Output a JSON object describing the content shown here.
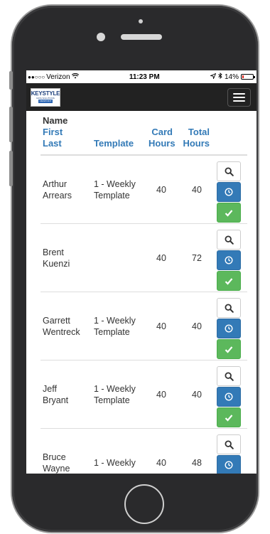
{
  "status_bar": {
    "signal": "●●○○○",
    "carrier": "Verizon",
    "wifi_icon": "wifi-icon",
    "time": "11:23 PM",
    "battery_pct": "14%",
    "battery_level": 0.14
  },
  "navbar": {
    "logo_line1": "KEYSTYLE",
    "logo_line2": "DATA SOLUTIONS",
    "logo_line3": "VIEWPOINT"
  },
  "table": {
    "headers": {
      "name": "Name",
      "first": "First",
      "last": "Last",
      "template": "Template",
      "card_line1": "Card",
      "card_line2": "Hours",
      "total_line1": "Total",
      "total_line2": "Hours"
    },
    "rows": [
      {
        "first": "Arthur",
        "last": "Arrears",
        "template": "1 - Weekly Template",
        "card_hours": "40",
        "total_hours": "40",
        "show_approve": true
      },
      {
        "first": "Brent",
        "last": "Kuenzi",
        "template": "",
        "card_hours": "40",
        "total_hours": "72",
        "show_approve": true
      },
      {
        "first": "Garrett",
        "last": "Wentreck",
        "template": "1 - Weekly Template",
        "card_hours": "40",
        "total_hours": "40",
        "show_approve": true
      },
      {
        "first": "Jeff",
        "last": "Bryant",
        "template": "1 - Weekly Template",
        "card_hours": "40",
        "total_hours": "40",
        "show_approve": true
      },
      {
        "first": "Bruce",
        "last": "Wayne",
        "template": "1 - Weekly",
        "card_hours": "40",
        "total_hours": "48",
        "show_approve": false
      }
    ]
  },
  "colors": {
    "link": "#337ab7",
    "primary_button": "#337ab7",
    "success_button": "#5cb85c",
    "navbar": "#222222"
  }
}
